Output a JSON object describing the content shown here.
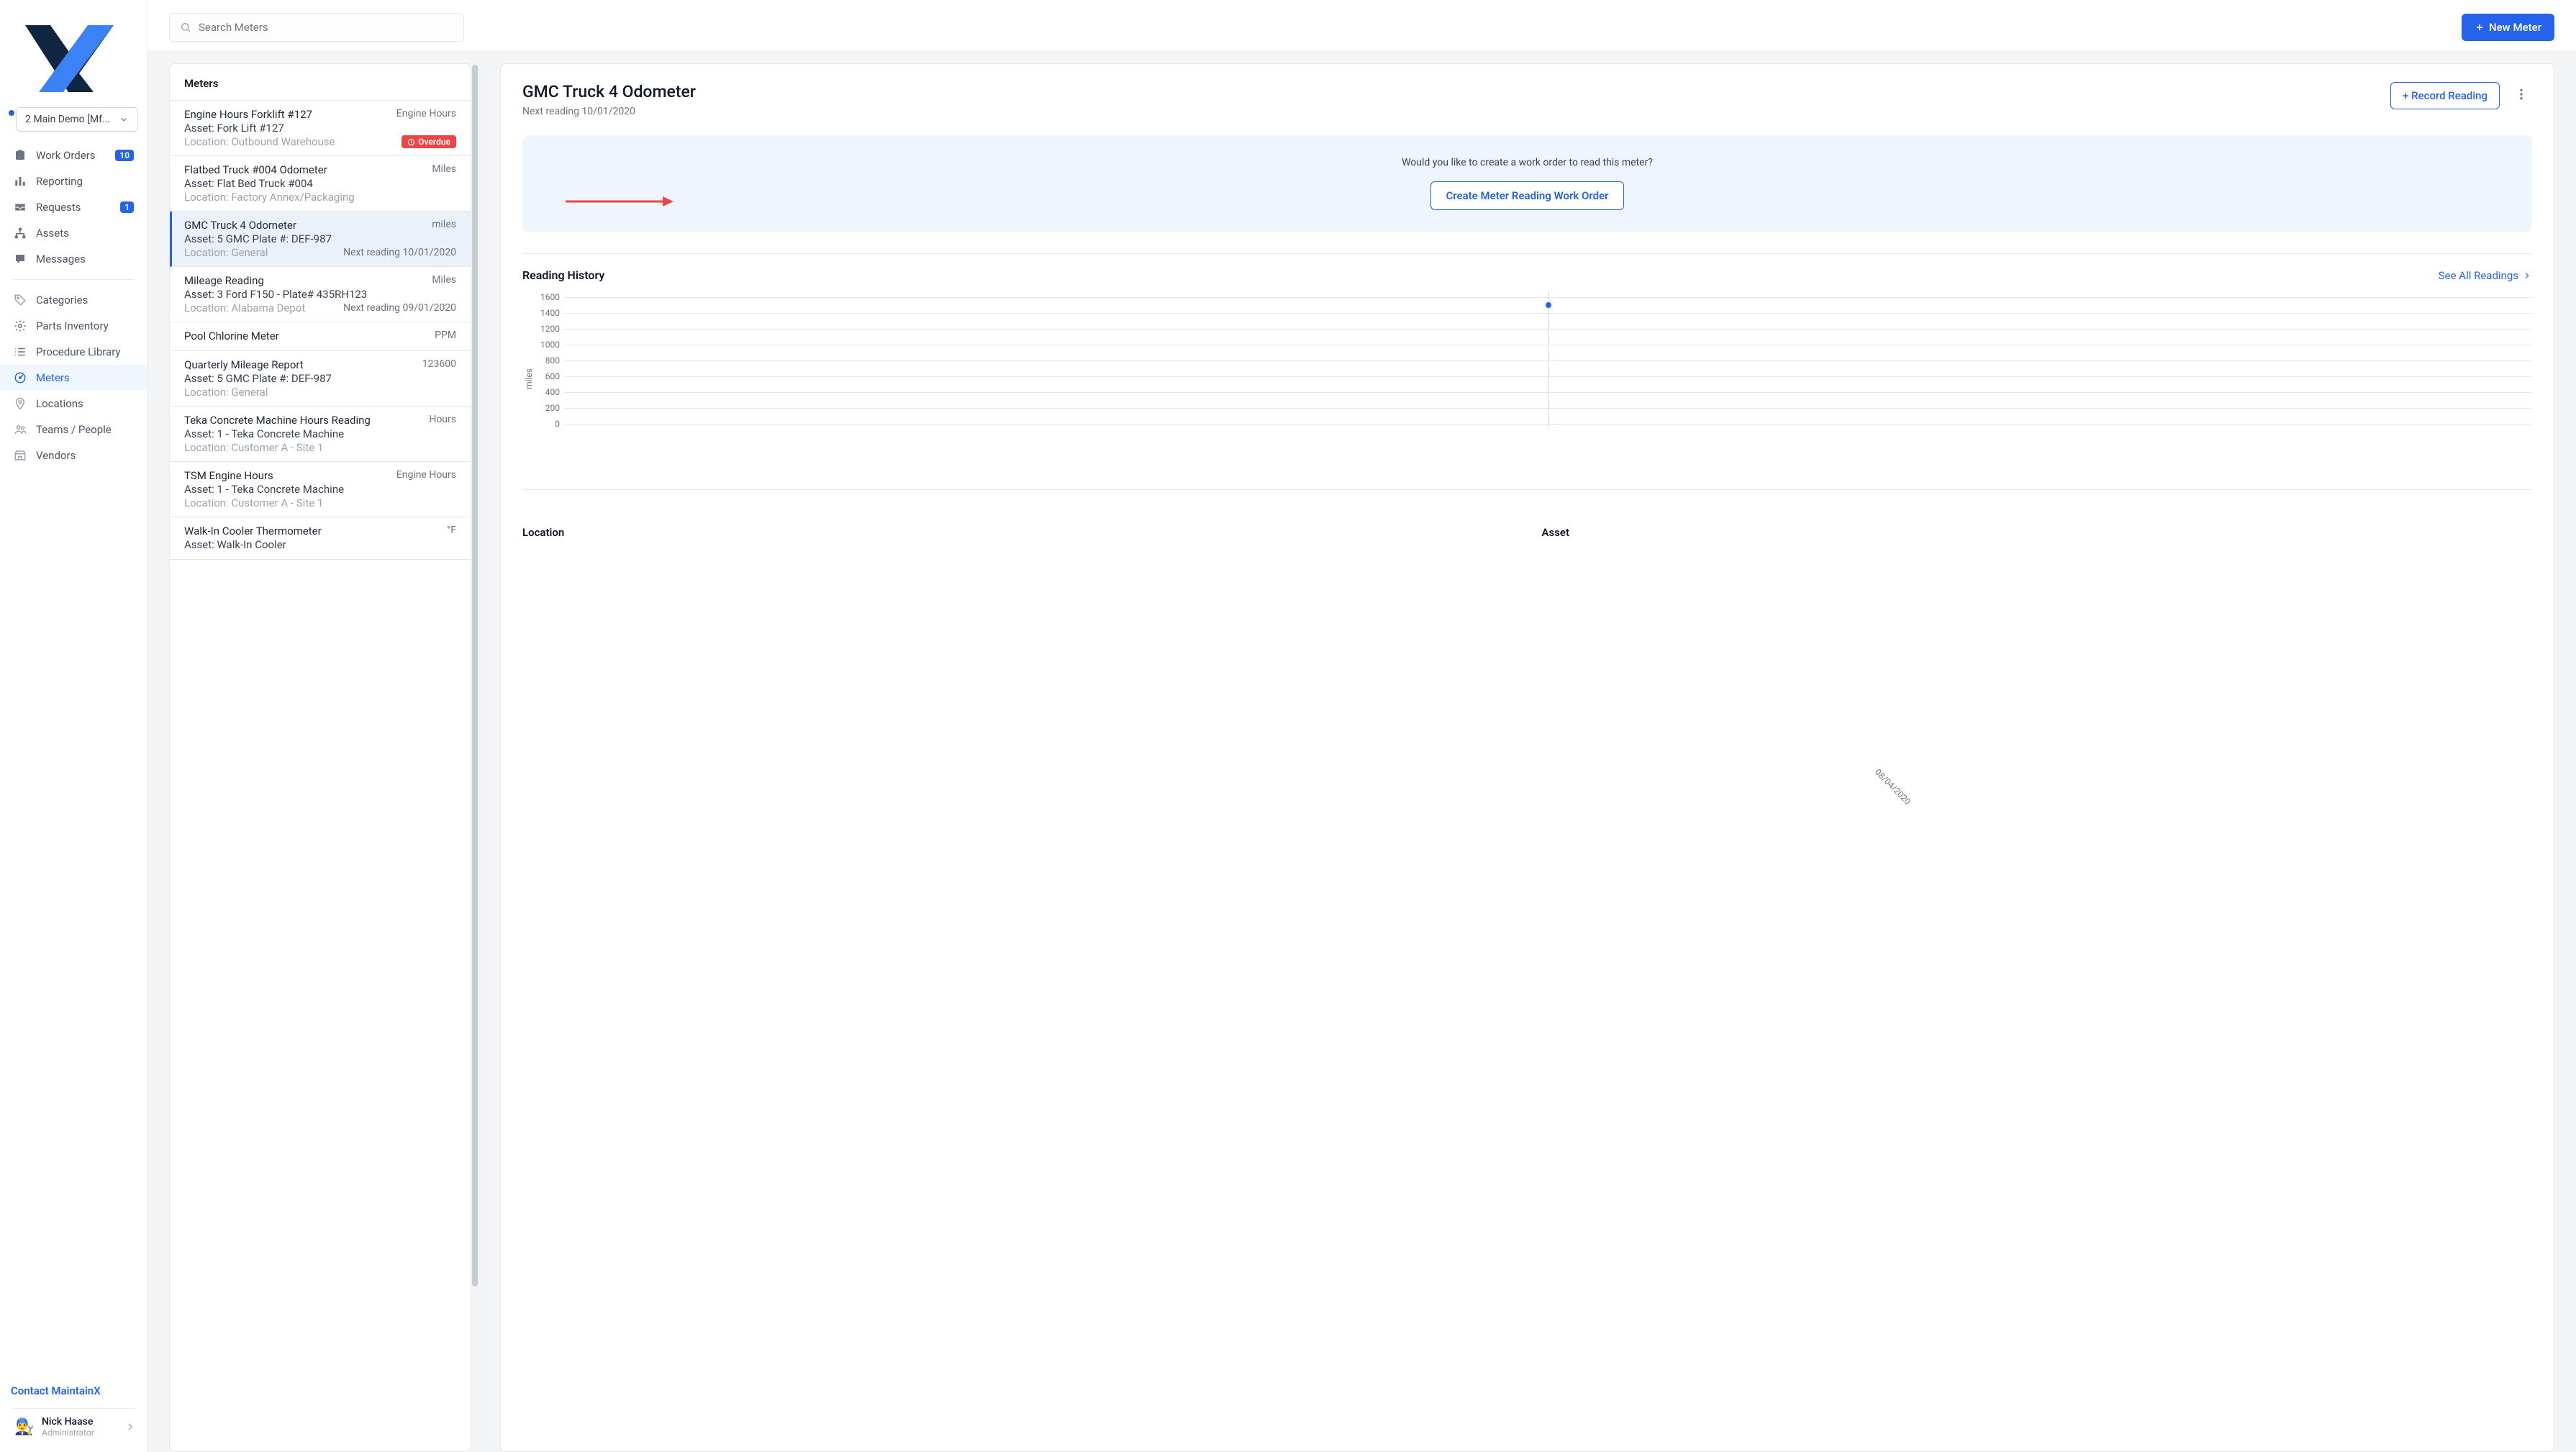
{
  "demo_org": "2 Main Demo [Mf...",
  "search": {
    "placeholder": "Search Meters"
  },
  "new_meter_label": "New Meter",
  "nav": [
    {
      "label": "Work Orders",
      "badge": "10"
    },
    {
      "label": "Reporting"
    },
    {
      "label": "Requests",
      "badge": "1"
    },
    {
      "label": "Assets"
    },
    {
      "label": "Messages"
    }
  ],
  "nav2": [
    {
      "label": "Categories"
    },
    {
      "label": "Parts Inventory"
    },
    {
      "label": "Procedure Library"
    },
    {
      "label": "Meters",
      "active": true
    },
    {
      "label": "Locations"
    },
    {
      "label": "Teams / People"
    },
    {
      "label": "Vendors"
    }
  ],
  "contact": "Contact MaintainX",
  "user": {
    "name": "Nick Haase",
    "role": "Administrator"
  },
  "meters_header": "Meters",
  "meters": [
    {
      "title": "Engine Hours Forklift #127",
      "asset": "Asset: Fork Lift #127",
      "location": "Location: Outbound Warehouse",
      "unit": "Engine Hours",
      "overdue": "Overdue"
    },
    {
      "title": "Flatbed Truck #004 Odometer",
      "asset": "Asset: Flat Bed Truck #004",
      "location": "Location: Factory Annex/Packaging",
      "unit": "Miles"
    },
    {
      "title": "GMC Truck 4 Odometer",
      "asset": "Asset: 5 GMC Plate #: DEF-987",
      "location": "Location: General",
      "unit": "miles",
      "next": "Next reading 10/01/2020",
      "selected": true
    },
    {
      "title": "Mileage Reading",
      "asset": "Asset: 3 Ford F150 - Plate# 435RH123",
      "location": "Location: Alabama Depot",
      "unit": "Miles",
      "next": "Next reading 09/01/2020"
    },
    {
      "title": "Pool Chlorine Meter",
      "unit": "PPM"
    },
    {
      "title": "Quarterly Mileage Report",
      "asset": "Asset: 5 GMC Plate #: DEF-987",
      "location": "Location: General",
      "unit": "123600"
    },
    {
      "title": "Teka Concrete Machine Hours Reading",
      "asset": "Asset: 1 - Teka Concrete Machine",
      "location": "Location: Customer A - Site 1",
      "unit": "Hours"
    },
    {
      "title": "TSM Engine Hours",
      "asset": "Asset: 1 - Teka Concrete Machine",
      "location": "Location: Customer A - Site 1",
      "unit": "Engine Hours"
    },
    {
      "title": "Walk-In Cooler Thermometer",
      "asset": "Asset: Walk-In Cooler",
      "unit": "°F"
    }
  ],
  "detail": {
    "title": "GMC Truck 4 Odometer",
    "sub": "Next reading 10/01/2020",
    "record_btn": "+ Record Reading",
    "prompt_text": "Would you like to create a work order to read this meter?",
    "prompt_btn": "Create Meter Reading Work Order",
    "history_title": "Reading History",
    "see_all": "See All Readings",
    "location_label": "Location",
    "asset_label": "Asset"
  },
  "chart_data": {
    "type": "line",
    "ylabel": "miles",
    "ylim": [
      0,
      1600
    ],
    "y_ticks": [
      1600,
      1400,
      1200,
      1000,
      800,
      600,
      400,
      200,
      0
    ],
    "x": [
      "08/04/2020"
    ],
    "series": [
      {
        "name": "miles",
        "values": [
          1500
        ]
      }
    ]
  }
}
